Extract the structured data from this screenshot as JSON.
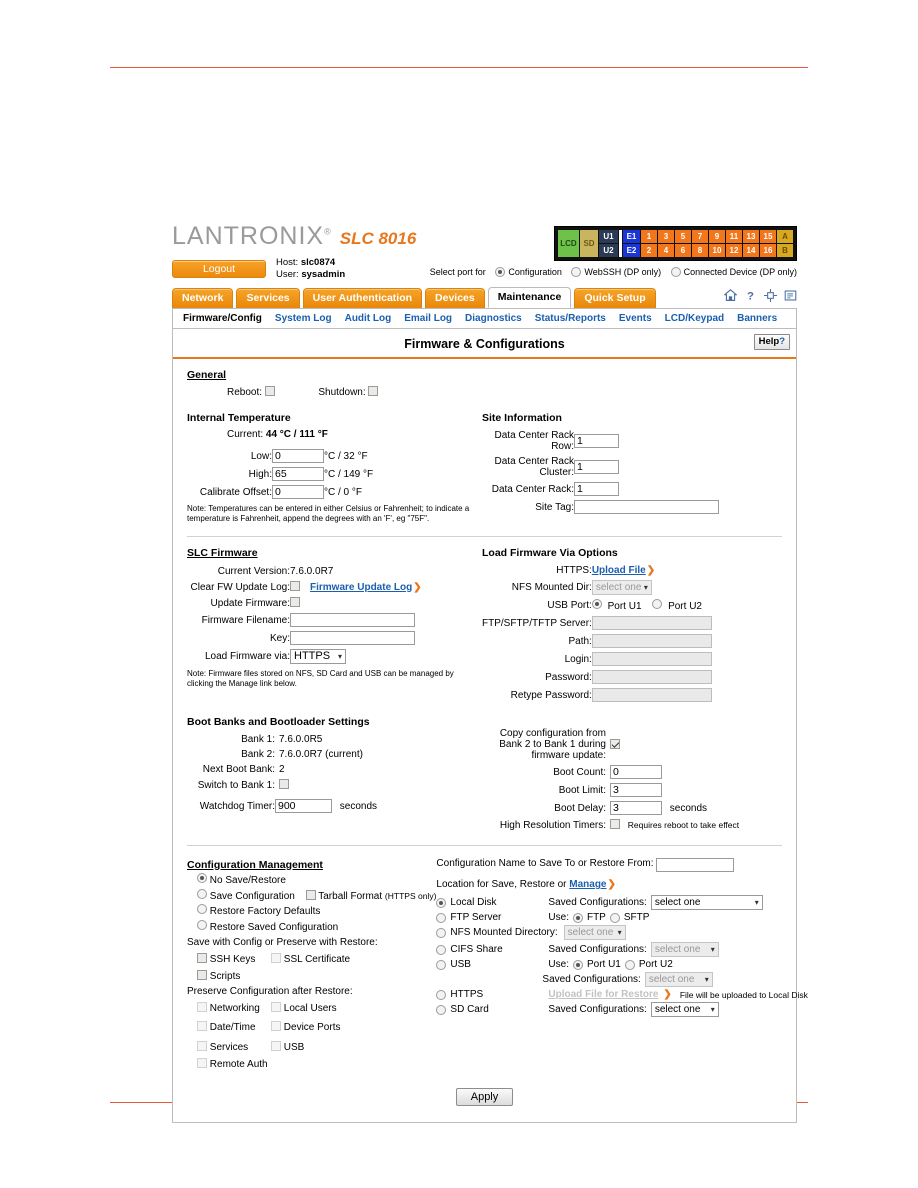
{
  "brand": {
    "name": "LANTRONIX",
    "registered": "®",
    "model": "SLC 8016"
  },
  "session": {
    "logout_label": "Logout",
    "host_label": "Host:",
    "host_value": "slc0874",
    "user_label": "User:",
    "user_value": "sysadmin"
  },
  "port_panel": {
    "lcd": "LCD",
    "sd": "SD",
    "u1": "U1",
    "u2": "U2",
    "e1": "E1",
    "e2": "E2",
    "row1": [
      "1",
      "3",
      "5",
      "7",
      "9",
      "11",
      "13",
      "15"
    ],
    "row2": [
      "2",
      "4",
      "6",
      "8",
      "10",
      "12",
      "14",
      "16"
    ],
    "a": "A",
    "b": "B",
    "select_label": "Select port for",
    "options": [
      {
        "label": "Configuration",
        "selected": true
      },
      {
        "label": "WebSSH (DP only)",
        "selected": false
      },
      {
        "label": "Connected Device (DP only)",
        "selected": false
      }
    ]
  },
  "tabs": [
    {
      "label": "Network",
      "active": false
    },
    {
      "label": "Services",
      "active": false
    },
    {
      "label": "User Authentication",
      "active": false
    },
    {
      "label": "Devices",
      "active": false
    },
    {
      "label": "Maintenance",
      "active": true
    },
    {
      "label": "Quick Setup",
      "active": false
    }
  ],
  "header_icons": [
    "home-icon",
    "help-icon",
    "expand-icon",
    "list-icon"
  ],
  "subnav": [
    {
      "label": "Firmware/Config",
      "current": true
    },
    {
      "label": "System Log",
      "current": false
    },
    {
      "label": "Audit Log",
      "current": false
    },
    {
      "label": "Email Log",
      "current": false
    },
    {
      "label": "Diagnostics",
      "current": false
    },
    {
      "label": "Status/Reports",
      "current": false
    },
    {
      "label": "Events",
      "current": false
    },
    {
      "label": "LCD/Keypad",
      "current": false
    },
    {
      "label": "Banners",
      "current": false
    }
  ],
  "panel": {
    "title": "Firmware & Configurations",
    "help_label": "Help",
    "help_mark": "?"
  },
  "general": {
    "heading": "General",
    "reboot_label": "Reboot:",
    "reboot_checked": false,
    "shutdown_label": "Shutdown:",
    "shutdown_checked": false
  },
  "temperature": {
    "heading": "Internal Temperature",
    "current_label": "Current:",
    "current_value": "44 °C / 111 °F",
    "low_label": "Low:",
    "low_value": "0",
    "low_unit": "°C / 32 °F",
    "high_label": "High:",
    "high_value": "65",
    "high_unit": "°C / 149 °F",
    "offset_label": "Calibrate Offset:",
    "offset_value": "0",
    "offset_unit": "°C / 0 °F",
    "note": "Note: Temperatures can be entered in either Celsius or Fahrenheit; to indicate a temperature is Fahrenheit, append the degrees with an 'F', eg \"75F\"."
  },
  "site": {
    "heading": "Site Information",
    "row_label": "Data Center Rack Row:",
    "row_value": "1",
    "cluster_label": "Data Center Rack Cluster:",
    "cluster_value": "1",
    "rack_label": "Data Center Rack:",
    "rack_value": "1",
    "tag_label": "Site Tag:",
    "tag_value": ""
  },
  "firmware": {
    "heading": "SLC Firmware",
    "current_version_label": "Current Version:",
    "current_version": "7.6.0.0R7",
    "clear_log_label": "Clear FW Update Log:",
    "clear_log_checked": false,
    "update_log_link": "Firmware Update Log",
    "update_fw_label": "Update Firmware:",
    "update_fw_checked": false,
    "filename_label": "Firmware Filename:",
    "filename_value": "",
    "key_label": "Key:",
    "key_value": "",
    "load_via_label": "Load Firmware via:",
    "load_via_value": "HTTPS",
    "note": "Note: Firmware files stored on NFS, SD Card and USB can be managed by clicking the Manage link below."
  },
  "load_options": {
    "heading": "Load Firmware Via Options",
    "https_label": "HTTPS:",
    "upload_link": "Upload File",
    "nfs_label": "NFS Mounted Dir:",
    "nfs_value": "select one",
    "usb_label": "USB Port:",
    "usb_u1": "Port U1",
    "usb_u1_selected": true,
    "usb_u2": "Port U2",
    "usb_u2_selected": false,
    "server_label": "FTP/SFTP/TFTP Server:",
    "server_value": "",
    "path_label": "Path:",
    "path_value": "",
    "login_label": "Login:",
    "login_value": "",
    "password_label": "Password:",
    "password_value": "",
    "retype_label": "Retype Password:",
    "retype_value": ""
  },
  "boot": {
    "heading": "Boot Banks and Bootloader Settings",
    "bank1_label": "Bank 1:",
    "bank1_value": "7.6.0.0R5",
    "bank2_label": "Bank 2:",
    "bank2_value": "7.6.0.0R7 (current)",
    "next_label": "Next Boot Bank:",
    "next_value": "2",
    "switch_label": "Switch to Bank 1:",
    "switch_checked": false,
    "watchdog_label": "Watchdog Timer:",
    "watchdog_value": "900",
    "watchdog_unit": "seconds",
    "copy_label": "Copy configuration from Bank 2 to Bank 1 during firmware update:",
    "copy_checked": true,
    "count_label": "Boot Count:",
    "count_value": "0",
    "limit_label": "Boot Limit:",
    "limit_value": "3",
    "delay_label": "Boot Delay:",
    "delay_value": "3",
    "delay_unit": "seconds",
    "hires_label": "High Resolution Timers:",
    "hires_checked": false,
    "hires_note": "Requires reboot to take effect"
  },
  "config_mgmt": {
    "heading": "Configuration Management",
    "modes": [
      {
        "label": "No Save/Restore",
        "selected": true
      },
      {
        "label": "Save Configuration",
        "selected": false
      },
      {
        "label": "Restore Factory Defaults",
        "selected": false
      },
      {
        "label": "Restore Saved Configuration",
        "selected": false
      }
    ],
    "tarball_label": "Tarball Format",
    "tarball_suffix": "(HTTPS only)",
    "tarball_checked": false,
    "save_with_heading": "Save with Config or Preserve with Restore:",
    "save_with": [
      {
        "label": "SSH Keys",
        "checked": false
      },
      {
        "label": "SSL Certificate",
        "checked": false
      },
      {
        "label": "Scripts",
        "checked": false
      }
    ],
    "preserve_heading": "Preserve Configuration after Restore:",
    "preserve": [
      {
        "label": "Networking",
        "checked": false
      },
      {
        "label": "Local Users",
        "checked": false
      },
      {
        "label": "Date/Time",
        "checked": false
      },
      {
        "label": "Device Ports",
        "checked": false
      },
      {
        "label": "Services",
        "checked": false
      },
      {
        "label": "USB",
        "checked": false
      },
      {
        "label": "Remote Auth",
        "checked": false
      }
    ],
    "config_name_label": "Configuration Name to Save To or Restore From:",
    "config_name_value": "",
    "location_label": "Location for Save, Restore or",
    "manage_link": "Manage",
    "saved_configs_label": "Saved Configurations:",
    "select_one": "select one",
    "use_label": "Use:",
    "locations": [
      {
        "name": "Local Disk",
        "selected": true
      },
      {
        "name": "FTP Server",
        "selected": false
      },
      {
        "name": "NFS Mounted Directory:",
        "selected": false
      },
      {
        "name": "CIFS Share",
        "selected": false
      },
      {
        "name": "USB",
        "selected": false
      },
      {
        "name": "HTTPS",
        "selected": false
      },
      {
        "name": "SD Card",
        "selected": false
      }
    ],
    "ftp_opt": "FTP",
    "ftp_selected": true,
    "sftp_opt": "SFTP",
    "sftp_selected": false,
    "usb_u1": "Port U1",
    "usb_u1_selected": true,
    "usb_u2": "Port U2",
    "usb_u2_selected": false,
    "https_upload_link": "Upload File for Restore",
    "https_note": "File will be uploaded to Local Disk"
  },
  "apply_label": "Apply"
}
